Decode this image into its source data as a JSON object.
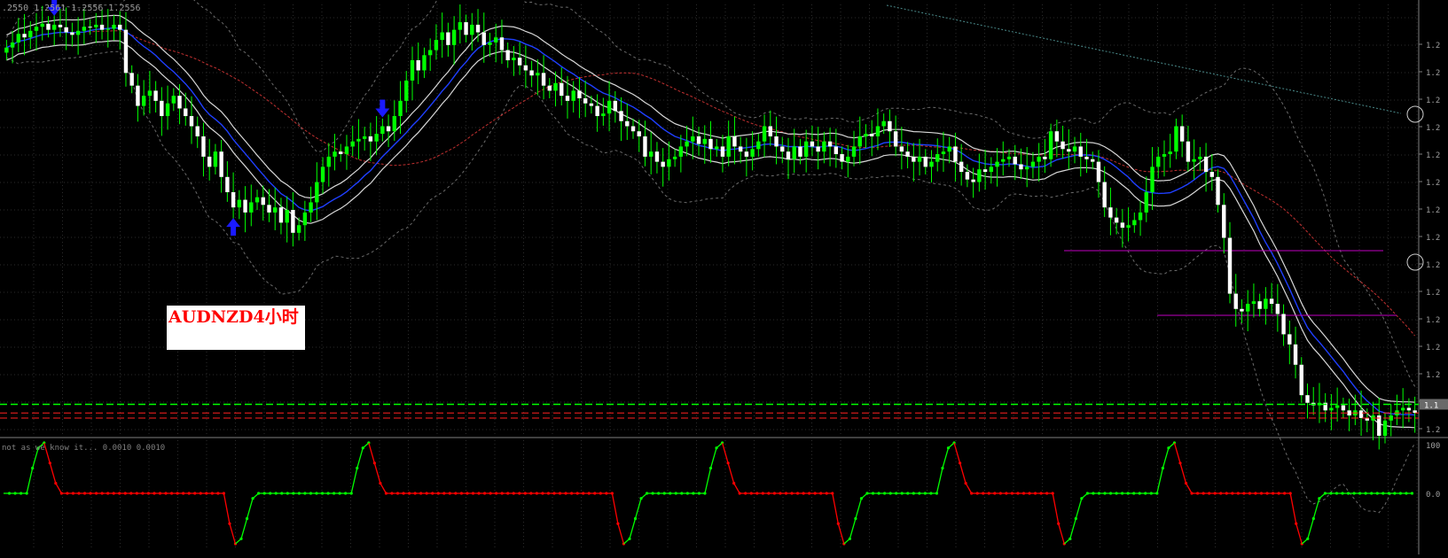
{
  "chart_data": [
    {
      "type": "candlestick",
      "title": "AUDNZD4小时",
      "header": ".2550 1.2561 1.2556 1.2556",
      "ohlc_start": 1.2505,
      "closes": [
        1.2515,
        1.2525,
        1.2542,
        1.2535,
        1.2548,
        1.2556,
        1.2562,
        1.255,
        1.256,
        1.2555,
        1.2545,
        1.254,
        1.2548,
        1.2556,
        1.2555,
        1.256,
        1.255,
        1.2552,
        1.256,
        1.255,
        1.2465,
        1.244,
        1.24,
        1.242,
        1.243,
        1.241,
        1.238,
        1.2405,
        1.242,
        1.2395,
        1.238,
        1.236,
        1.234,
        1.23,
        1.228,
        1.231,
        1.226,
        1.223,
        1.22,
        1.2215,
        1.219,
        1.221,
        1.222,
        1.2205,
        1.219,
        1.22,
        1.217,
        1.2195,
        1.215,
        1.2165,
        1.219,
        1.221,
        1.225,
        1.228,
        1.23,
        1.231,
        1.2305,
        1.232,
        1.233,
        1.2335,
        1.234,
        1.233,
        1.2345,
        1.236,
        1.235,
        1.238,
        1.241,
        1.245,
        1.249,
        1.247,
        1.25,
        1.251,
        1.253,
        1.2545,
        1.252,
        1.255,
        1.2565,
        1.254,
        1.256,
        1.2545,
        1.252,
        1.2525,
        1.2535,
        1.251,
        1.249,
        1.2495,
        1.248,
        1.247,
        1.246,
        1.2465,
        1.244,
        1.243,
        1.2445,
        1.242,
        1.241,
        1.243,
        1.2415,
        1.2405,
        1.24,
        1.238,
        1.2385,
        1.241,
        1.239,
        1.237,
        1.236,
        1.235,
        1.234,
        1.23,
        1.231,
        1.229,
        1.228,
        1.2295,
        1.23,
        1.232,
        1.233,
        1.234,
        1.2325,
        1.2335,
        1.2315,
        1.232,
        1.23,
        1.234,
        1.232,
        1.231,
        1.23,
        1.2315,
        1.233,
        1.236,
        1.234,
        1.232,
        1.231,
        1.2295,
        1.232,
        1.23,
        1.233,
        1.232,
        1.231,
        1.233,
        1.232,
        1.2305,
        1.229,
        1.23,
        1.232,
        1.234,
        1.2345,
        1.234,
        1.236,
        1.237,
        1.235,
        1.232,
        1.231,
        1.23,
        1.229,
        1.23,
        1.228,
        1.229,
        1.2305,
        1.231,
        1.232,
        1.229,
        1.227,
        1.2255,
        1.225,
        1.2275,
        1.227,
        1.228,
        1.229,
        1.2295,
        1.23,
        1.2285,
        1.2275,
        1.228,
        1.229,
        1.23,
        1.2295,
        1.235,
        1.233,
        1.2315,
        1.231,
        1.232,
        1.23,
        1.2295,
        1.229,
        1.225,
        1.22,
        1.218,
        1.217,
        1.216,
        1.2165,
        1.2175,
        1.219,
        1.223,
        1.228,
        1.23,
        1.2305,
        1.231,
        1.236,
        1.233,
        1.229,
        1.2295,
        1.23,
        1.227,
        1.226,
        1.2205,
        1.214,
        1.203,
        1.2,
        1.1995,
        1.201,
        1.2015,
        1.2,
        1.202,
        1.201,
        1.199,
        1.195,
        1.193,
        1.189,
        1.183,
        1.1815,
        1.181,
        1.1815,
        1.18,
        1.1805,
        1.181,
        1.18,
        1.179,
        1.18,
        1.1785,
        1.178,
        1.179,
        1.175,
        1.178,
        1.179,
        1.18,
        1.1805,
        1.18,
        1.1795
      ],
      "yrange": [
        1.175,
        1.26
      ],
      "lines": {
        "green_dashed": 1.1812,
        "red_dashed_1": 1.1795,
        "red_dashed_2": 1.1785
      },
      "colors": {
        "bull": "#00ff00",
        "bear": "#ffffff",
        "ma_blue": "#1f3fff",
        "band": "#d8d8d8",
        "red_ma": "#c03030",
        "magenta": "#c000c0",
        "arrow": "#1a1aff"
      },
      "arrows": [
        {
          "dir": "down",
          "index": 8
        },
        {
          "dir": "up",
          "index": 38
        },
        {
          "dir": "down",
          "index": 63
        },
        {
          "dir": "up",
          "index": 246
        }
      ],
      "right_ticks": [
        "1.2",
        "1.2",
        "1.2",
        "1.2",
        "1.2",
        "1.2",
        "1.2",
        "1.2",
        "1.2",
        "1.2",
        "1.2",
        "1.2",
        "1.2",
        "1.2",
        "1.2"
      ],
      "current_price_tag": "1.1"
    },
    {
      "type": "line",
      "label": "not as we know it... 0.0010 0.0010",
      "ytick_top": "100",
      "ytick_mid": "0.0",
      "ytick_bottom": "",
      "cycles": [
        {
          "low_start": 0,
          "rise_to": 100,
          "peak_index": 7,
          "fall_to": 50,
          "flat_until": 38,
          "dip_to": 0,
          "dip_index": 40
        }
      ],
      "series_values": [
        50,
        50,
        50,
        50,
        50,
        75,
        95,
        100,
        80,
        60,
        50,
        50,
        50,
        50,
        50,
        50,
        50,
        50,
        50,
        50,
        50,
        50,
        50,
        50,
        50,
        50,
        50,
        50,
        50,
        50,
        50,
        50,
        50,
        50,
        50,
        50,
        50,
        50,
        50,
        20,
        0,
        5,
        25,
        45,
        50,
        50,
        50,
        50,
        50,
        50,
        50,
        50,
        50,
        50,
        50,
        50,
        50,
        50,
        50,
        50,
        50,
        75,
        95,
        100,
        80,
        60,
        50,
        50,
        50,
        50,
        50,
        50,
        50,
        50,
        50,
        50,
        50,
        50,
        50,
        50,
        50,
        50,
        50,
        50,
        50,
        50,
        50,
        50,
        50,
        50,
        50,
        50,
        50,
        50,
        50,
        50,
        50,
        50,
        50,
        50,
        50,
        50,
        50,
        50,
        50,
        50,
        20,
        0,
        5,
        25,
        45,
        50,
        50,
        50,
        50,
        50,
        50,
        50,
        50,
        50,
        50,
        50,
        75,
        95,
        100,
        80,
        60,
        50,
        50,
        50,
        50,
        50,
        50,
        50,
        50,
        50,
        50,
        50,
        50,
        50,
        50,
        50,
        50,
        50,
        20,
        0,
        5,
        25,
        45,
        50,
        50,
        50,
        50,
        50,
        50,
        50,
        50,
        50,
        50,
        50,
        50,
        50,
        75,
        95,
        100,
        80,
        60,
        50,
        50,
        50,
        50,
        50,
        50,
        50,
        50,
        50,
        50,
        50,
        50,
        50,
        50,
        50,
        20,
        0,
        5,
        25,
        45,
        50,
        50,
        50,
        50,
        50,
        50,
        50,
        50,
        50,
        50,
        50,
        50,
        50,
        75,
        95,
        100,
        80,
        60,
        50,
        50,
        50,
        50,
        50,
        50,
        50,
        50,
        50,
        50,
        50,
        50,
        50,
        50,
        50,
        50,
        50,
        50,
        20,
        0,
        5,
        25,
        45,
        50,
        50,
        50,
        50,
        50,
        50,
        50,
        50,
        50,
        50,
        50,
        50,
        50,
        50,
        50,
        50
      ],
      "colors": {
        "up": "#00ff00",
        "down": "#ff0000"
      }
    }
  ]
}
